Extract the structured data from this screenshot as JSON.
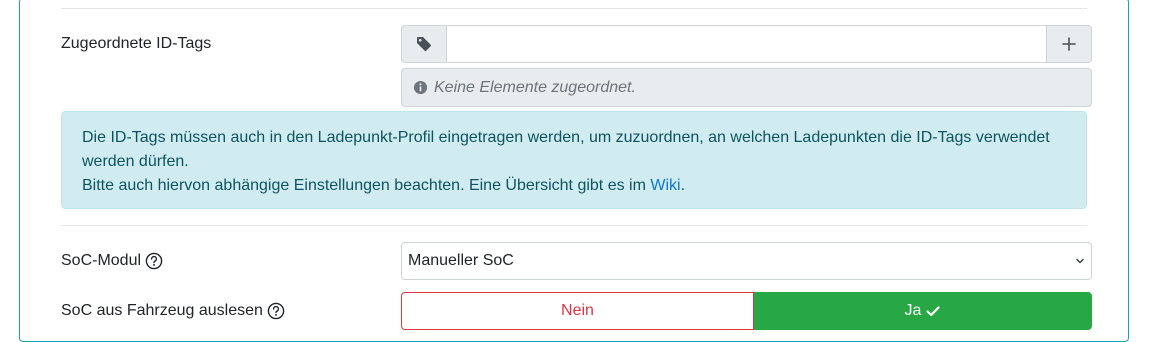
{
  "id_tags": {
    "label": "Zugeordnete ID-Tags",
    "input_value": "",
    "prepend_icon": "tag-icon",
    "add_icon": "plus-icon",
    "empty_icon": "info-circle-icon",
    "empty_text": "Keine Elemente zugeordnet."
  },
  "info_alert": {
    "line1": "Die ID-Tags müssen auch in den Ladepunkt-Profil eingetragen werden, um zuzuordnen, an welchen Ladepunkten die ID-Tags verwendet werden dürfen.",
    "line2_prefix": "Bitte auch hiervon abhängige Einstellungen beachten. Eine Übersicht gibt es im ",
    "link_text": "Wiki",
    "line2_suffix": "."
  },
  "soc_module": {
    "label": "SoC-Modul",
    "help_icon": "question-circle-icon",
    "selected": "Manueller SoC",
    "chevron_icon": "chevron-down-icon"
  },
  "soc_read": {
    "label": "SoC aus Fahrzeug auslesen",
    "help_icon": "question-circle-icon",
    "no_label": "Nein",
    "yes_label": "Ja",
    "selected": "Ja",
    "check_icon": "check-icon"
  },
  "colors": {
    "card_border": "#17a2b8",
    "alert_bg": "#d1ecf1",
    "alert_text": "#0c5460",
    "link": "#0b76d1",
    "danger": "#dc3545",
    "success": "#28a745"
  }
}
